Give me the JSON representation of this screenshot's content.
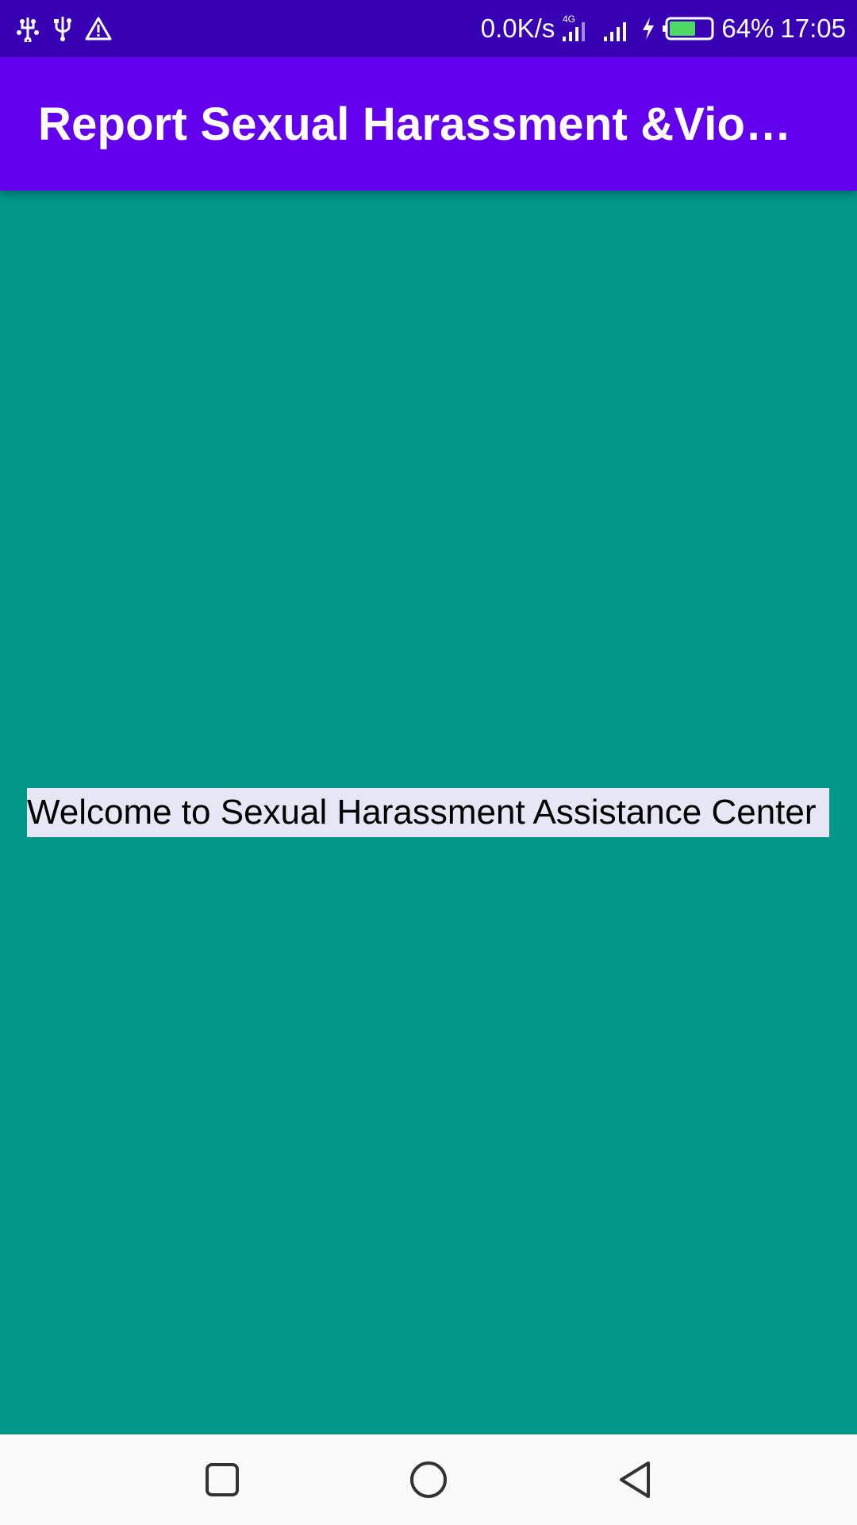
{
  "status_bar": {
    "left_icons": [
      "usb-debug-icon",
      "usb-icon",
      "warning-icon"
    ],
    "network_speed": "0.0K/s",
    "network_type": "4G",
    "battery_percent": "64%",
    "battery_level": 0.64,
    "time": "17:05"
  },
  "app_bar": {
    "title": "Report Sexual Harassment &Viole..."
  },
  "main": {
    "welcome_text": "Welcome to Sexual Harassment Assistance Center"
  },
  "nav_bar": {
    "buttons": [
      "recent-apps-icon",
      "home-icon",
      "back-icon"
    ]
  },
  "colors": {
    "status_bar": "#3700B3",
    "app_bar": "#6200EE",
    "background": "#009688",
    "welcome_highlight": "#E6E6F5",
    "battery_fill": "#4CD964"
  }
}
